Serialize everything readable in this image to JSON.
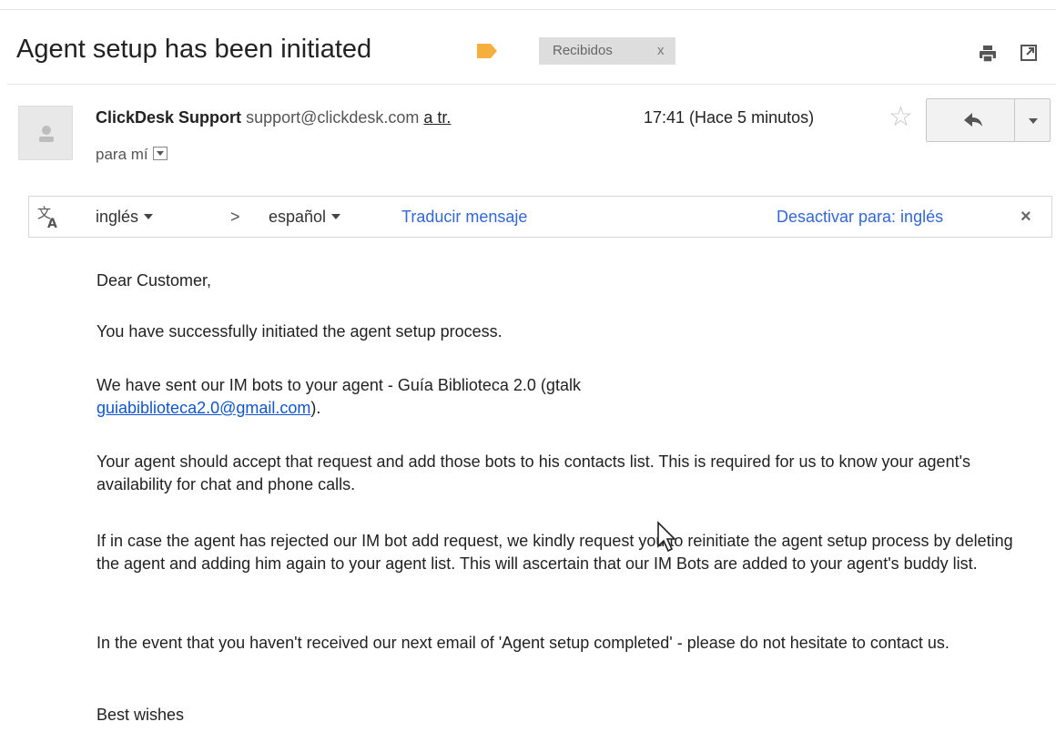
{
  "email": {
    "subject": "Agent setup has been initiated",
    "label_color": "#f6ae3c",
    "inbox_chip": {
      "label": "Recibidos",
      "remove": "x"
    },
    "toolbar_icons": [
      "print-icon",
      "open-new-window-icon"
    ],
    "sender": {
      "name": "ClickDesk Support",
      "email": "support@clickdesk.com",
      "via": "a tr.",
      "to_label": "para mí"
    },
    "time": "17:41 (Hace 5 minutos)",
    "actions": {
      "reply_icon": "reply-icon",
      "more_icon": "chevron-down-icon",
      "star_icon": "star-icon"
    }
  },
  "translate": {
    "from_lang": "inglés",
    "separator": ">",
    "to_lang": "español",
    "translate_link": "Traducir mensaje",
    "disable_link": "Desactivar para: inglés",
    "close": "×"
  },
  "body": {
    "greeting": "Dear Customer,",
    "p1": "You have successfully initiated the agent setup process.",
    "p2_a": "We have sent our IM bots to your agent - Guía Biblioteca 2.0 (gtalk",
    "p2_link": "guiabiblioteca2.0@gmail.com",
    "p2_b": ").",
    "p3": "Your agent should accept that request and add those bots to his contacts list. This is required for us to know your agent's availability for chat and phone calls.",
    "p4": "If in case the agent has rejected our IM bot add request, we kindly request you to reinitiate the agent setup process by deleting the agent and adding him again to your agent list. This will ascertain that our IM Bots are added to your agent's buddy list.",
    "p5": "In the event that you haven't received our next email of 'Agent setup completed' - please do not hesitate to contact us.",
    "closing": "Best wishes"
  }
}
